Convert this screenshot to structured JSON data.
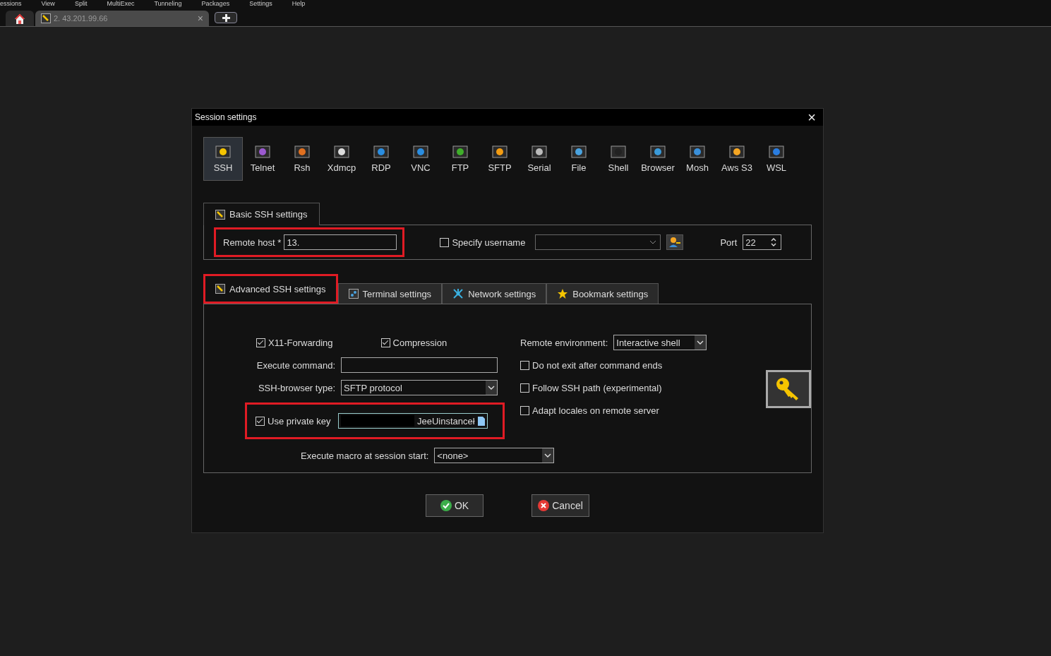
{
  "menu": [
    "essions",
    "View",
    "Split",
    "MultiExec",
    "Tunneling",
    "Packages",
    "Settings",
    "Help"
  ],
  "tabs": [
    {
      "kind": "home",
      "selected": false
    },
    {
      "kind": "session",
      "label": "2. 43.201.99.66",
      "close": "×",
      "selected": true
    },
    {
      "kind": "new",
      "selected": false
    }
  ],
  "dialog": {
    "title": "Session settings",
    "close": "×",
    "session_types": [
      {
        "label": "SSH",
        "selected": true
      },
      {
        "label": "Telnet",
        "selected": false
      },
      {
        "label": "Rsh",
        "selected": false
      },
      {
        "label": "Xdmcp",
        "selected": false
      },
      {
        "label": "RDP",
        "selected": false
      },
      {
        "label": "VNC",
        "selected": false
      },
      {
        "label": "FTP",
        "selected": false
      },
      {
        "label": "SFTP",
        "selected": false
      },
      {
        "label": "Serial",
        "selected": false
      },
      {
        "label": "File",
        "selected": false
      },
      {
        "label": "Shell",
        "selected": false
      },
      {
        "label": "Browser",
        "selected": false
      },
      {
        "label": "Mosh",
        "selected": false
      },
      {
        "label": "Aws S3",
        "selected": false
      },
      {
        "label": "WSL",
        "selected": false
      }
    ],
    "basic": {
      "tab": "Basic SSH settings",
      "remote_host_label": "Remote host *",
      "remote_host": "13.",
      "specify_username": {
        "label": "Specify username",
        "checked": false
      },
      "port_label": "Port",
      "port": "22"
    },
    "adv_tabs": [
      {
        "label": "Advanced SSH settings",
        "selected": true
      },
      {
        "label": "Terminal settings",
        "selected": false
      },
      {
        "label": "Network settings",
        "selected": false
      },
      {
        "label": "Bookmark settings",
        "selected": false
      }
    ],
    "advanced": {
      "x11": {
        "label": "X11-Forwarding",
        "checked": true
      },
      "compression": {
        "label": "Compression",
        "checked": true
      },
      "remote_env_label": "Remote environment:",
      "remote_env": "Interactive shell",
      "exec_label": "Execute command:",
      "browser_label": "SSH-browser type:",
      "browser": "SFTP protocol",
      "private_key": {
        "label": "Use private key",
        "checked": true
      },
      "key_path": "JeeUinstanceł",
      "options": [
        {
          "label": "Do not exit after command ends",
          "checked": false
        },
        {
          "label": "Follow SSH path (experimental)",
          "checked": false
        },
        {
          "label": "Adapt locales on remote server",
          "checked": false
        }
      ],
      "macro_label": "Execute macro at session start:",
      "macro": "<none>"
    },
    "buttons": [
      {
        "kind": "ok",
        "label": "OK"
      },
      {
        "kind": "cancel",
        "label": "Cancel"
      }
    ]
  }
}
